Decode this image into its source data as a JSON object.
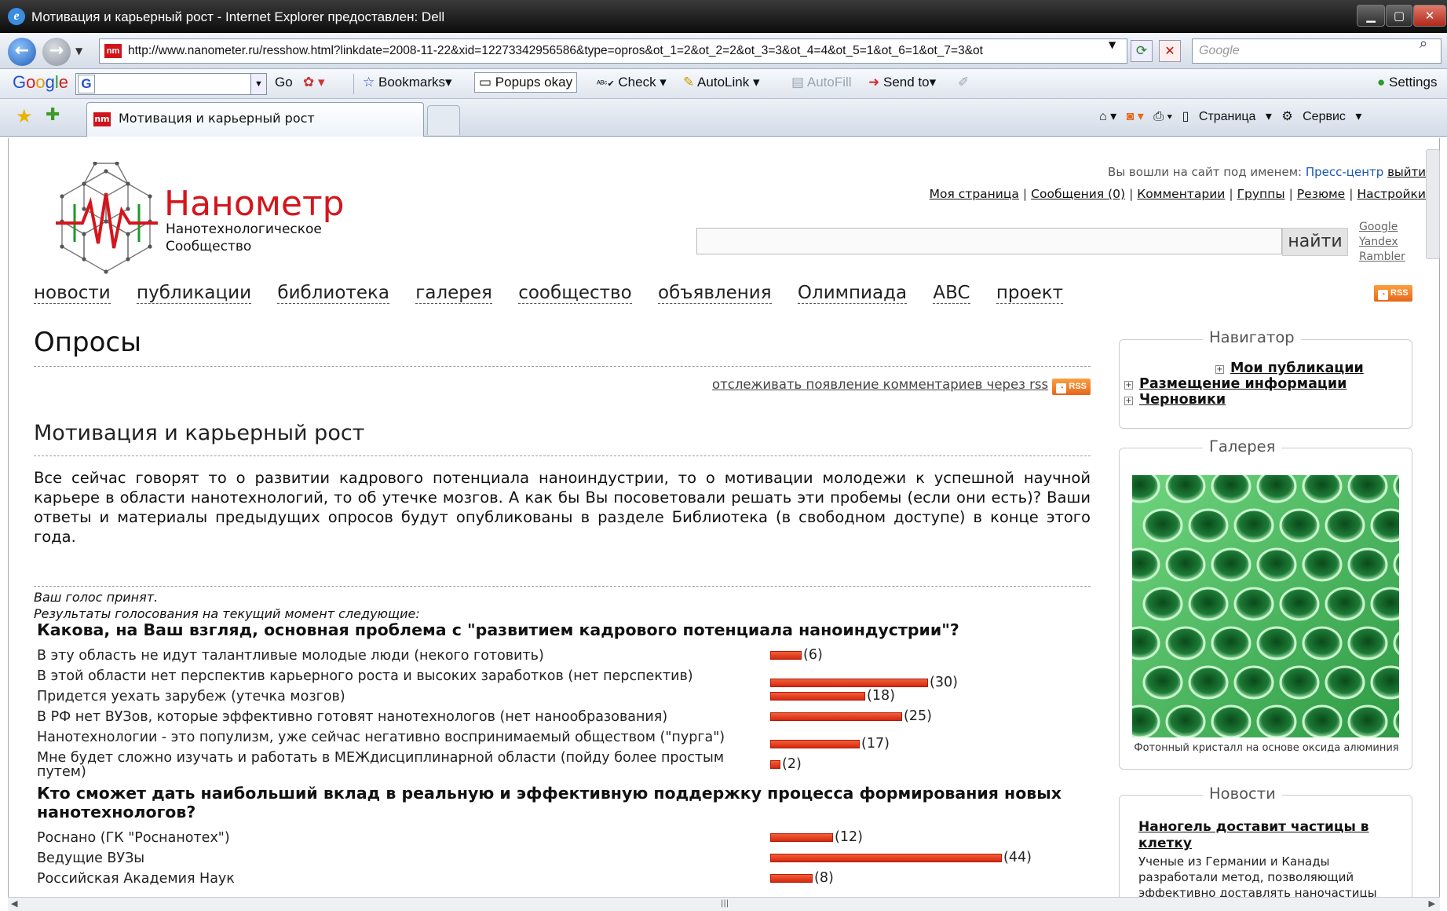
{
  "browser": {
    "window_title": "Мотивация и карьерный рост - Internet Explorer предоставлен: Dell",
    "url": "http://www.nanometer.ru/resshow.html?linkdate=2008-11-22&xid=12273342956586&type=opros&ot_1=2&ot_2=2&ot_3=3&ot_4=4&ot_5=1&ot_6=1&ot_7=3&ot",
    "search_placeholder": "Google",
    "tab_title": "Мотивация и карьерный рост",
    "icons": [
      "ie-icon",
      "back-arrow-icon",
      "forward-arrow-icon",
      "refresh-icon",
      "stop-icon",
      "search-icon",
      "star-icon",
      "add-favorite-icon",
      "home-icon",
      "rss-icon",
      "print-icon",
      "page-icon",
      "gear-icon"
    ]
  },
  "google_toolbar": {
    "go": "Go",
    "bookmarks": "Bookmarks▾",
    "popups": "Popups okay",
    "check": "Check",
    "autolink": "AutoLink",
    "autofill": "AutoFill",
    "send_to": "Send to▾",
    "settings": "Settings"
  },
  "command_bar": {
    "page": "Страница",
    "tools": "Сервис"
  },
  "site": {
    "logo_title": "Нанометр",
    "logo_sub1": "Нанотехнологическое",
    "logo_sub2": "Сообщество",
    "login_prefix": "Вы вошли на сайт под именем:",
    "login_user": "Пресс-центр",
    "logout": "выйти",
    "user_menu": [
      "Моя страница",
      "Сообщения (0)",
      "Комментарии",
      "Группы",
      "Резюме",
      "Настройки"
    ],
    "search_button": "найти",
    "search_engines": [
      "Google",
      "Yandex",
      "Rambler"
    ],
    "main_nav": [
      "новости",
      "публикации",
      "библиотека",
      "галерея",
      "сообщество",
      "объявления",
      "Олимпиада",
      "ABC",
      "проект"
    ],
    "rss_label": "RSS"
  },
  "main": {
    "page_title": "Опросы",
    "rss_link": "отслеживать появление комментариев через rss",
    "poll_title": "Мотивация и карьерный рост",
    "intro": "Все сейчас говорят то о развитии кадрового потенциала наноиндустрии, то о мотивации молодежи к успешной научной карьере в области нанотехнологий, то об утечке мозгов. А как бы Вы посоветовали решать эти пробемы (если они есть)? Ваши ответы и материалы предыдущих опросов будут опубликованы в разделе Библиотека (в свободном доступе) в конце этого года.",
    "vote_accepted": "Ваш голос принят.",
    "results_intro": "Результаты голосования на текущий момент следующие:",
    "questions": [
      {
        "text": "Какова, на Ваш взгляд, основная проблема с \"развитием кадрового потенциала наноиндустрии\"?",
        "answers": [
          {
            "text": "В эту область не идут талантливые молодые люди (некого готовить)",
            "count": 6,
            "label": "(6)"
          },
          {
            "text": "В этой области нет перспектив карьерного роста и высоких заработков (нет перспектив)",
            "count": 30,
            "label": "(30)"
          },
          {
            "text": "Придется уехать зарубеж (утечка мозгов)",
            "count": 18,
            "label": "(18)"
          },
          {
            "text": "В РФ нет ВУЗов, которые эффективно готовят нанотехнологов (нет нанообразования)",
            "count": 25,
            "label": "(25)"
          },
          {
            "text": "Нанотехнологии - это популизм, уже сейчас негативно воспринимаемый обществом (\"пурга\")",
            "count": 17,
            "label": "(17)"
          },
          {
            "text": "Мне будет сложно изучать и работать в МЕЖдисциплинарной области (пойду более простым путем)",
            "count": 2,
            "label": "(2)"
          }
        ]
      },
      {
        "text": "Кто сможет дать наибольший вклад в реальную и эффективную поддержку процесса формирования новых нанотехнологов?",
        "answers": [
          {
            "text": "Роснано (ГК \"Роснанотех\")",
            "count": 12,
            "label": "(12)"
          },
          {
            "text": "Ведущие ВУЗы",
            "count": 44,
            "label": "(44)"
          },
          {
            "text": "Российская Академия Наук",
            "count": 8,
            "label": "(8)"
          }
        ]
      }
    ]
  },
  "sidebar": {
    "navigator_title": "Навигатор",
    "navigator_items": [
      "Мои публикации",
      "Размещение информации",
      "Черновики"
    ],
    "gallery_title": "Галерея",
    "gallery_caption": "Фотонный кристалл на основе оксида алюминия",
    "news_title": "Новости",
    "news_headline": "Наногель доставит частицы в клетку",
    "news_text": "Ученые из Германии и Канады разработали метод, позволяющий эффективно доставлять наночастицы"
  },
  "colors": {
    "bar": "#e0401e",
    "logo_red": "#d4161c",
    "login_blue": "#1a55b8"
  }
}
